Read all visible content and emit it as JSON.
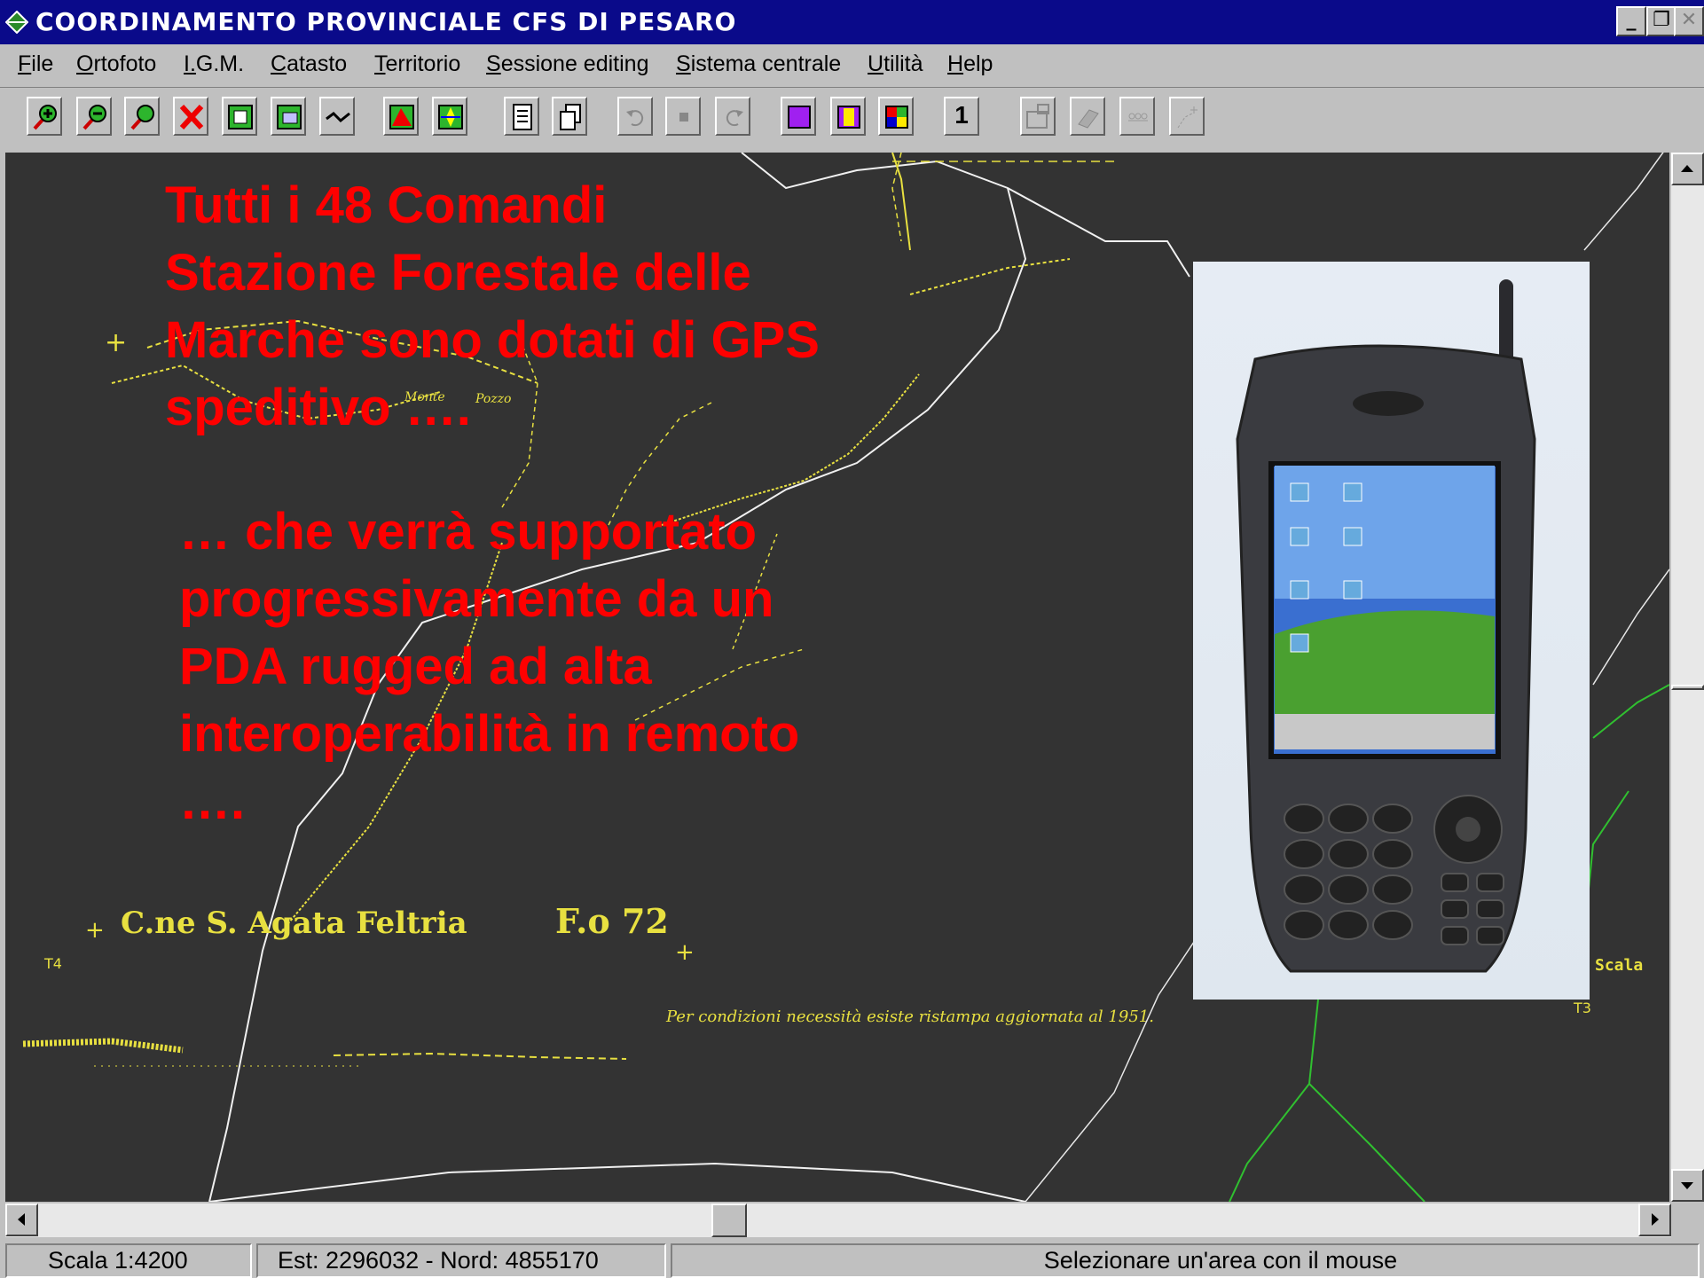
{
  "window": {
    "title": "COORDINAMENTO PROVINCIALE CFS DI PESARO",
    "controls": [
      "minimize",
      "restore",
      "close"
    ]
  },
  "menu": [
    "File",
    "Ortofoto",
    "I.G.M.",
    "Catasto",
    "Territorio",
    "Sessione editing",
    "Sistema centrale",
    "Utilità",
    "Help"
  ],
  "toolbar": {
    "page_number": "1",
    "icons": [
      "zoom-in-icon",
      "zoom-out-icon",
      "zoom-icon",
      "delete-icon",
      "frame-icon",
      "layer-frame-icon",
      "line-icon",
      "map-color-icon",
      "map-gps-icon",
      "document-icon",
      "copy-icon",
      "undo-icon",
      "stop-icon",
      "redo-icon",
      "purple-square-icon",
      "yellow-split-icon",
      "four-color-icon",
      "edit-window-icon",
      "eraser-icon",
      "label-icon",
      "point-add-icon"
    ]
  },
  "map": {
    "overlay_text_1": "Tutti i 48 Comandi\nStazione Forestale delle\nMarche sono dotati di GPS\nspeditivo ….",
    "overlay_text_2": "… che verrà supportato\nprogressivamente da un\nPDA rugged ad alta\ninteroperabilità in remoto\n….",
    "map_labels": {
      "municipality": "C.ne S. Agata Feltria",
      "sheet": "F.o 72",
      "note": "Per condizioni necessità esiste ristampa aggiornata al 1951.",
      "scale_label": "Scala",
      "t4": "T4",
      "t3": "T3",
      "monte": "Monte",
      "pozzo": "Pozzo"
    }
  },
  "statusbar": {
    "scale": "Scala 1:4200",
    "coords": "Est: 2296032 - Nord: 4855170",
    "message": "Selezionare un'area con il mouse"
  }
}
